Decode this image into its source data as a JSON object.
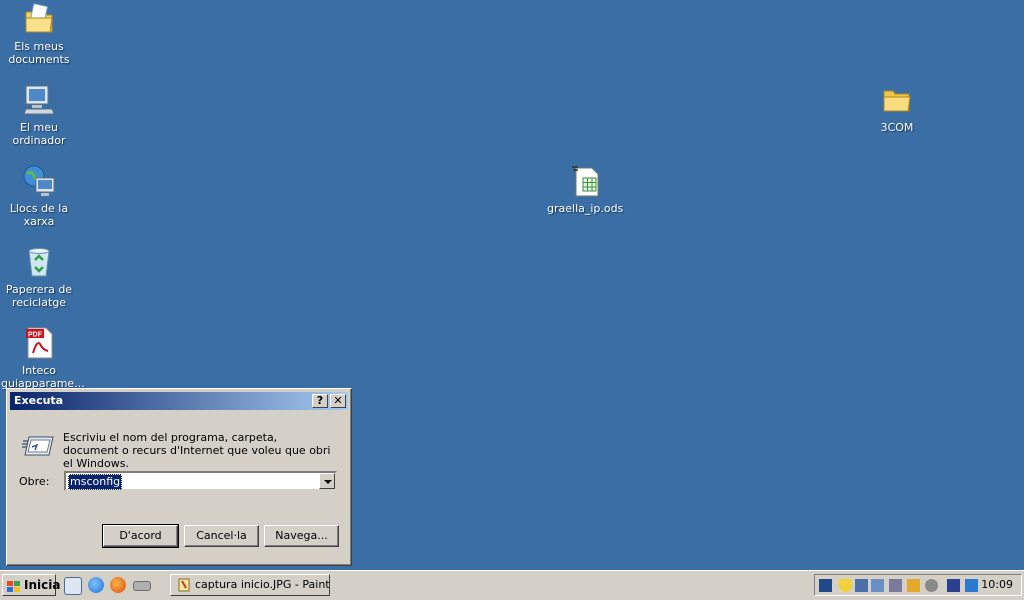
{
  "desktop": {
    "icons": [
      {
        "label_line1": "Els meus",
        "label_line2": "documents",
        "icon": "my-documents-icon"
      },
      {
        "label_line1": "El meu",
        "label_line2": "ordinador",
        "icon": "my-computer-icon"
      },
      {
        "label_line1": "Llocs de la",
        "label_line2": "xarxa",
        "icon": "network-places-icon"
      },
      {
        "label_line1": "Paperera de",
        "label_line2": "reciclatge",
        "icon": "recycle-bin-icon"
      },
      {
        "label_line1": "Inteco",
        "label_line2": "guiapparame...",
        "icon": "pdf-icon"
      },
      {
        "label_line1": "graella_ip.ods",
        "icon": "spreadsheet-file-icon"
      },
      {
        "label_line1": "3COM",
        "icon": "folder-icon"
      }
    ]
  },
  "run_dialog": {
    "title": "Executa",
    "help_button": "?",
    "close_button": "✕",
    "description": "Escriviu el nom del programa, carpeta, document o recurs d'Internet que voleu que obri el Windows.",
    "open_label": "Obre:",
    "open_value": "msconfig",
    "buttons": {
      "ok": "D'acord",
      "cancel": "Cancel·la",
      "browse": "Navega..."
    }
  },
  "taskbar": {
    "start_label": "Inicia",
    "task_button": "captura inicio.JPG - Paint",
    "clock": "10:09"
  },
  "colors": {
    "desktop": "#3a6ea5",
    "title_bar": "#0a246a",
    "selection": "#0a246a",
    "face": "#d4d0c8"
  }
}
